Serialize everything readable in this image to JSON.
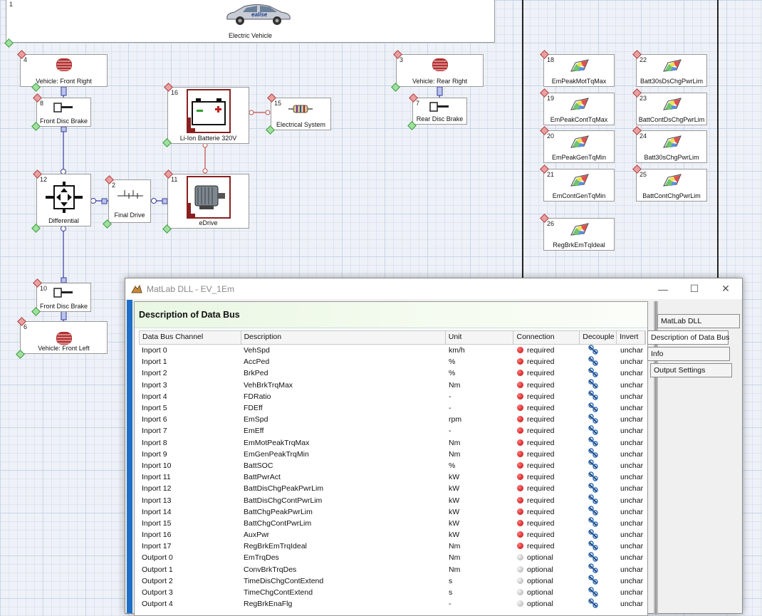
{
  "diagram": {
    "blocks": [
      {
        "id": "ev",
        "num": "1",
        "label": "Electric Vehicle"
      },
      {
        "id": "front-right",
        "num": "4",
        "label": "Vehicle: Front Right"
      },
      {
        "id": "front-disc-brake-top",
        "num": "8",
        "label": "Front Disc Brake"
      },
      {
        "id": "li-ion",
        "num": "16",
        "label": "Li-Ion Batterie 320V"
      },
      {
        "id": "electrical-system",
        "num": "15",
        "label": "Electrical System"
      },
      {
        "id": "rear-right",
        "num": "3",
        "label": "Vehicle: Rear Right"
      },
      {
        "id": "rear-disc-brake",
        "num": "7",
        "label": "Rear Disc Brake"
      },
      {
        "id": "differential",
        "num": "12",
        "label": "Differential"
      },
      {
        "id": "final-drive",
        "num": "2",
        "label": "Final Drive"
      },
      {
        "id": "edrive",
        "num": "11",
        "label": "eDrive"
      },
      {
        "id": "front-disc-brake-bottom",
        "num": "10",
        "label": "Front Disc Brake"
      },
      {
        "id": "front-left",
        "num": "6",
        "label": "Vehicle: Front Left"
      },
      {
        "id": "map-18",
        "num": "18",
        "label": "EmPeakMotTqMax"
      },
      {
        "id": "map-19",
        "num": "19",
        "label": "EmPeakContTqMax"
      },
      {
        "id": "map-20",
        "num": "20",
        "label": "EmPeakGenTqMin"
      },
      {
        "id": "map-21",
        "num": "21",
        "label": "EmContGenTqMin"
      },
      {
        "id": "map-26",
        "num": "26",
        "label": "RegBrkEmTqIdeal"
      },
      {
        "id": "map-22",
        "num": "22",
        "label": "Batt30sDsChgPwrLim"
      },
      {
        "id": "map-23",
        "num": "23",
        "label": "BattContDsChgPwrLim"
      },
      {
        "id": "map-24",
        "num": "24",
        "label": "Batt30sChgPwrLim"
      },
      {
        "id": "map-25",
        "num": "25",
        "label": "BattContChgPwrLim"
      }
    ]
  },
  "dialog": {
    "title": "MatLab DLL - EV_1Em",
    "panel_title": "Description of Data Bus",
    "columns": [
      "Data Bus Channel",
      "Description",
      "Unit",
      "Connection",
      "Decouple",
      "Invert"
    ],
    "rows": [
      [
        "Inport 0",
        "VehSpd",
        "km/h",
        "required",
        "unchar"
      ],
      [
        "Inport 1",
        "AccPed",
        "%",
        "required",
        "unchar"
      ],
      [
        "Inport 2",
        "BrkPed",
        "%",
        "required",
        "unchar"
      ],
      [
        "Inport 3",
        "VehBrkTrqMax",
        "Nm",
        "required",
        "unchar"
      ],
      [
        "Inport 4",
        "FDRatio",
        "-",
        "required",
        "unchar"
      ],
      [
        "Inport 5",
        "FDEff",
        "-",
        "required",
        "unchar"
      ],
      [
        "Inport 6",
        "EmSpd",
        "rpm",
        "required",
        "unchar"
      ],
      [
        "Inport 7",
        "EmEff",
        "-",
        "required",
        "unchar"
      ],
      [
        "Inport 8",
        "EmMotPeakTrqMax",
        "Nm",
        "required",
        "unchar"
      ],
      [
        "Inport 9",
        "EmGenPeakTrqMin",
        "Nm",
        "required",
        "unchar"
      ],
      [
        "Inport 10",
        "BattSOC",
        "%",
        "required",
        "unchar"
      ],
      [
        "Inport 11",
        "BattPwrAct",
        "kW",
        "required",
        "unchar"
      ],
      [
        "Inport 12",
        "BattDisChgPeakPwrLim",
        "kW",
        "required",
        "unchar"
      ],
      [
        "Inport 13",
        "BattDisChgContPwrLim",
        "kW",
        "required",
        "unchar"
      ],
      [
        "Inport 14",
        "BattChgPeakPwrLim",
        "kW",
        "required",
        "unchar"
      ],
      [
        "Inport 15",
        "BattChgContPwrLim",
        "kW",
        "required",
        "unchar"
      ],
      [
        "Inport 16",
        "AuxPwr",
        "kW",
        "required",
        "unchar"
      ],
      [
        "Inport 17",
        "RegBrkEmTrqIdeal",
        "Nm",
        "required",
        "unchar"
      ],
      [
        "Outport 0",
        "EmTrqDes",
        "Nm",
        "optional",
        "unchar"
      ],
      [
        "Outport 1",
        "ConvBrkTrqDes",
        "Nm",
        "optional",
        "unchar"
      ],
      [
        "Outport 2",
        "TimeDisChgContExtend",
        "s",
        "optional",
        "unchar"
      ],
      [
        "Outport 3",
        "TimeChgContExtend",
        "s",
        "optional",
        "unchar"
      ],
      [
        "Outport 4",
        "RegBrkEnaFlg",
        "-",
        "optional",
        "unchar"
      ]
    ],
    "tabs": [
      "MatLab DLL",
      "Description of Data Bus",
      "Info",
      "Output Settings"
    ],
    "window_buttons": {
      "minimize": "—",
      "maximize": "☐",
      "close": "✕"
    }
  }
}
